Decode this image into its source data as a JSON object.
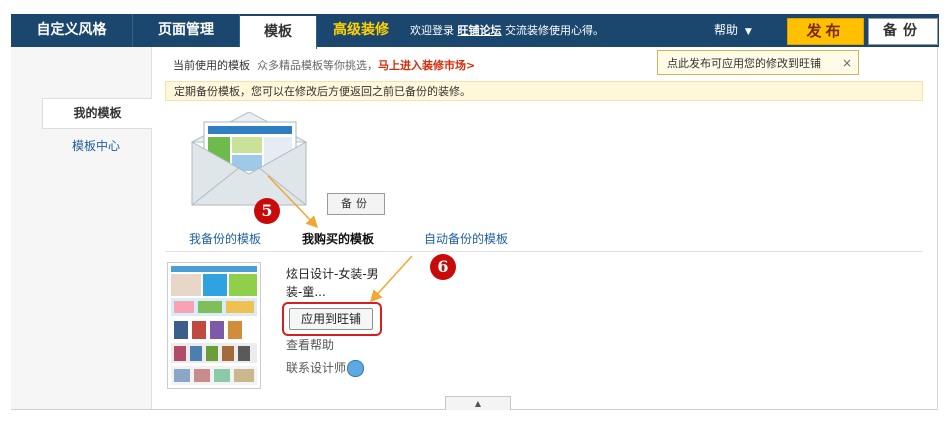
{
  "nav": {
    "tabs": [
      {
        "label": "自定义风格"
      },
      {
        "label": "页面管理"
      },
      {
        "label": "模板"
      },
      {
        "label": "高级装修"
      }
    ],
    "welcome_prefix": "欢迎登录",
    "forum_link": "旺铺论坛",
    "welcome_suffix": "交流装修使用心得。",
    "help_label": "帮助",
    "publish_label": "发布",
    "backup_label": "备份"
  },
  "sidebar": {
    "items": [
      {
        "label": "我的模板"
      },
      {
        "label": "模板中心"
      }
    ]
  },
  "current": {
    "label": "当前使用的模板",
    "muted": "众多精品模板等你挑选，",
    "link": "马上进入装修市场>"
  },
  "tooltip": {
    "text": "点此发布可应用您的修改到旺铺",
    "close": "×"
  },
  "notice": "定期备份模板，您可以在修改后方便返回之前已备份的装修。",
  "backup_button": "备份",
  "badges": [
    "5",
    "6"
  ],
  "subtabs": [
    "我备份的模板",
    "我购买的模板",
    "自动备份的模板"
  ],
  "item": {
    "title": "炫日设计-女装-男装-童...",
    "apply_label": "应用到旺铺",
    "help_label": "查看帮助",
    "contact_label": "联系设计师"
  },
  "colors": {
    "nav_bg": "#1b466d",
    "publish_bg": "#ffc000",
    "accent_red": "#d62b0b",
    "link_blue": "#1f5fa0",
    "badge_red": "#c80a0a",
    "arrow_orange": "#f0a830"
  },
  "icons": {
    "help_dropdown": "chevron-down-icon",
    "tooltip_close": "close-icon",
    "contact": "chat-bubble-icon",
    "scroll": "arrow-up-icon"
  }
}
